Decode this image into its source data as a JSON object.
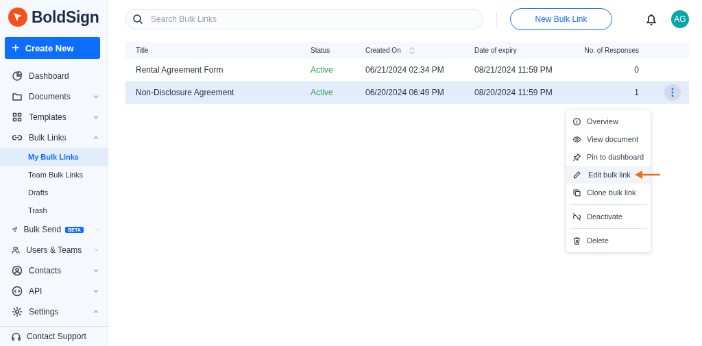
{
  "brand": {
    "name": "BoldSign"
  },
  "sidebar": {
    "create_button": {
      "label": "Create New",
      "icon": "+"
    },
    "items": [
      {
        "label": "Dashboard",
        "kind": "link",
        "selected": false
      },
      {
        "label": "Documents",
        "kind": "group",
        "expanded": false,
        "selected": false
      },
      {
        "label": "Templates",
        "kind": "group",
        "expanded": false,
        "selected": false
      },
      {
        "label": "Bulk Links",
        "kind": "group",
        "expanded": true,
        "selected": false,
        "children": [
          {
            "label": "My Bulk Links",
            "selected": true
          },
          {
            "label": "Team Bulk Links",
            "selected": false
          },
          {
            "label": "Drafts",
            "selected": false
          },
          {
            "label": "Trash",
            "selected": false
          }
        ]
      },
      {
        "label": "Bulk Send",
        "kind": "group",
        "expanded": false,
        "selected": false,
        "badge": "BETA"
      },
      {
        "label": "Users & Teams",
        "kind": "group",
        "expanded": false,
        "selected": false
      },
      {
        "label": "Contacts",
        "kind": "group",
        "expanded": false,
        "selected": false
      },
      {
        "label": "API",
        "kind": "group",
        "expanded": false,
        "selected": false
      },
      {
        "label": "Settings",
        "kind": "group",
        "expanded": true,
        "selected": false
      }
    ],
    "footer": {
      "label": "Contact Support"
    }
  },
  "topbar": {
    "search": {
      "placeholder": "Search Bulk Links"
    },
    "new_button": {
      "label": "New Bulk Link"
    },
    "avatar": {
      "initials": "AG"
    }
  },
  "table": {
    "columns": [
      {
        "label": "Title",
        "sortable": false
      },
      {
        "label": "Status",
        "sortable": false
      },
      {
        "label": "Created On",
        "sortable": true
      },
      {
        "label": "Date of expiry",
        "sortable": false
      },
      {
        "label": "No. of Responses",
        "sortable": false
      }
    ],
    "rows": [
      {
        "title": "Rental Agreement Form",
        "status": "Active",
        "created_on": "06/21/2024 02:34 PM",
        "expiry": "08/21/2024 11:59 PM",
        "responses": "0",
        "selected": false
      },
      {
        "title": "Non-Disclosure Agreement",
        "status": "Active",
        "created_on": "06/20/2024 06:49 PM",
        "expiry": "08/20/2024 11:59 PM",
        "responses": "1",
        "selected": true
      }
    ]
  },
  "context_menu": {
    "items": [
      {
        "kind": "item",
        "label": "Overview",
        "selected": false
      },
      {
        "kind": "item",
        "label": "View document",
        "selected": false
      },
      {
        "kind": "item",
        "label": "Pin to dashboard",
        "selected": false
      },
      {
        "kind": "item",
        "label": "Edit bulk link",
        "selected": true
      },
      {
        "kind": "item",
        "label": "Clone bulk link",
        "selected": false
      },
      {
        "kind": "divider"
      },
      {
        "kind": "item",
        "label": "Deactivate",
        "selected": false
      },
      {
        "kind": "divider"
      },
      {
        "kind": "item",
        "label": "Delete",
        "selected": false
      }
    ]
  }
}
